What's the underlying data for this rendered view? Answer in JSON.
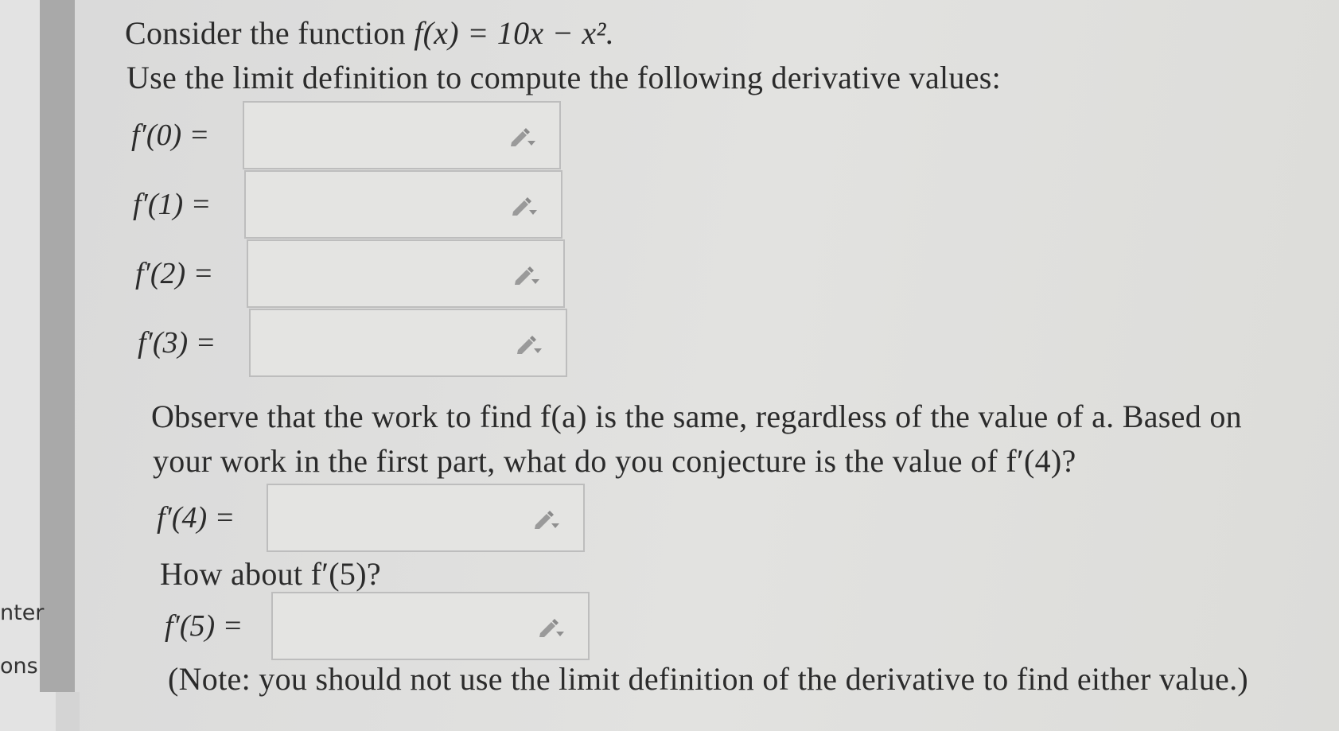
{
  "sidebar": {
    "label_top": "nter",
    "label_bottom": "ons"
  },
  "question": {
    "intro_prefix": "Consider the function ",
    "function_expr": "f(x) = 10x − x².",
    "instruction": "Use the limit definition to compute the following derivative values:",
    "answers_part1": [
      {
        "label": "f′(0) =",
        "value": ""
      },
      {
        "label": "f′(1) =",
        "value": ""
      },
      {
        "label": "f′(2) =",
        "value": ""
      },
      {
        "label": "f′(3) =",
        "value": ""
      }
    ],
    "observe_line1": "Observe that the work to find f(a) is the same, regardless of the value of a. Based on",
    "observe_line2": "your work in the first part, what do you conjecture is the value of f′(4)?",
    "answer_f4": {
      "label": "f′(4) =",
      "value": ""
    },
    "how_about": "How about f′(5)?",
    "answer_f5": {
      "label": "f′(5) =",
      "value": ""
    },
    "note": "(Note: you should not use the limit definition of the derivative to find either value.)"
  },
  "icons": {
    "edit": "pencil-dropdown-icon"
  },
  "colors": {
    "background": "#e0e0de",
    "box_border": "#bdbdbd",
    "sidebar_bar": "#a9a9a9"
  }
}
